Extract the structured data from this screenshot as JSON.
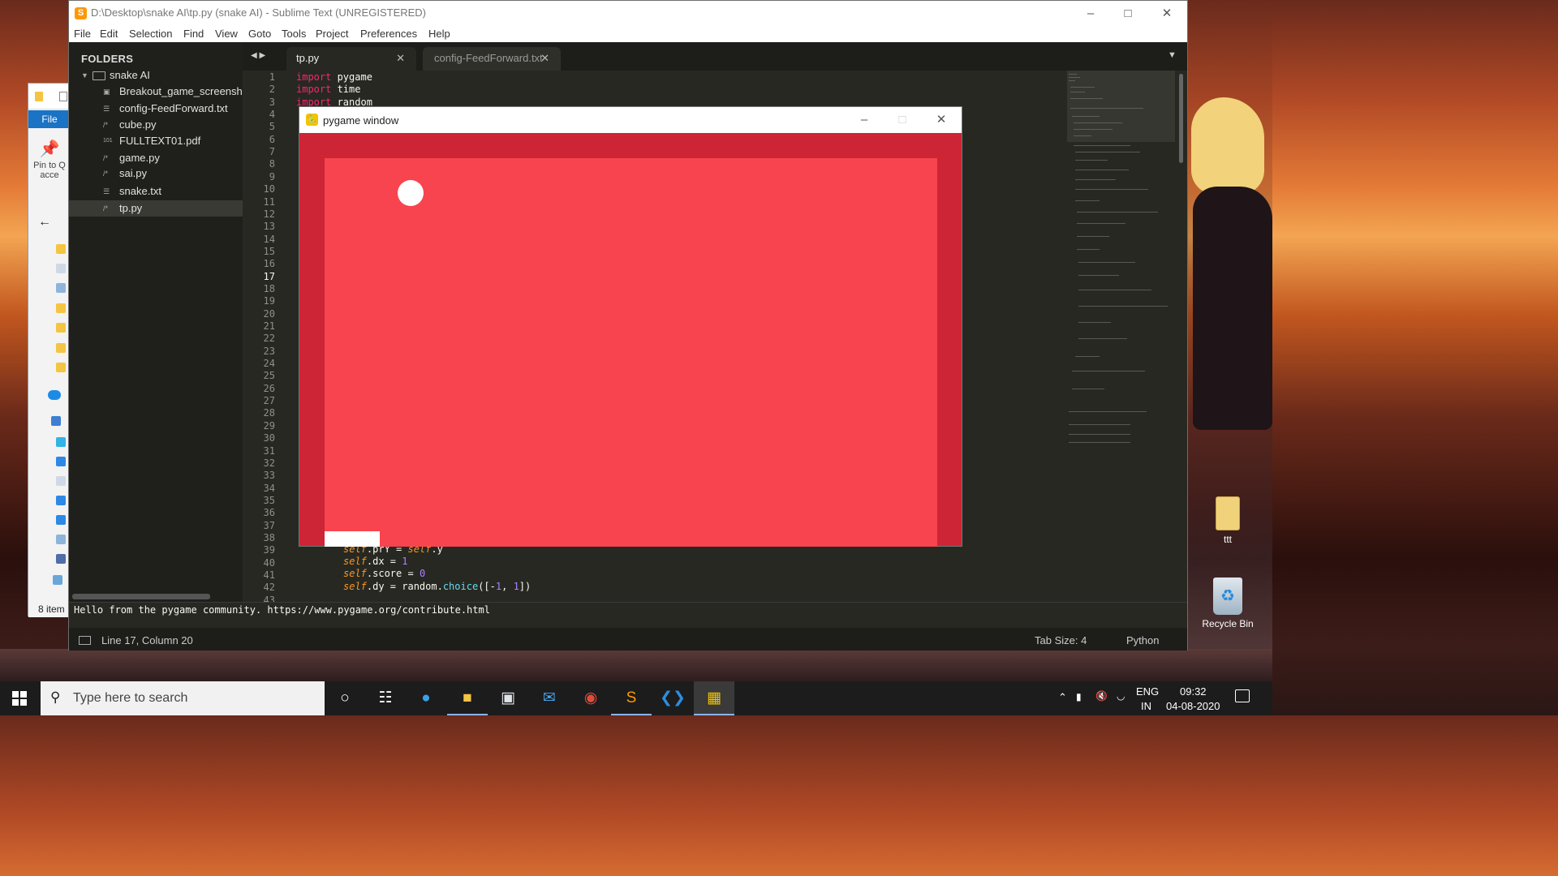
{
  "sublime": {
    "title": "D:\\Desktop\\snake AI\\tp.py (snake AI) - Sublime Text (UNREGISTERED)",
    "menu": [
      "File",
      "Edit",
      "Selection",
      "Find",
      "View",
      "Goto",
      "Tools",
      "Project",
      "Preferences",
      "Help"
    ],
    "sidebar": {
      "header": "FOLDERS",
      "root": "snake AI",
      "items": [
        {
          "label": "Breakout_game_screensh",
          "icon": "image-icon"
        },
        {
          "label": "config-FeedForward.txt",
          "icon": "text-icon"
        },
        {
          "label": "cube.py",
          "icon": "code-icon"
        },
        {
          "label": "FULLTEXT01.pdf",
          "icon": "binary-icon"
        },
        {
          "label": "game.py",
          "icon": "code-icon"
        },
        {
          "label": "sai.py",
          "icon": "code-icon"
        },
        {
          "label": "snake.txt",
          "icon": "text-icon"
        },
        {
          "label": "tp.py",
          "icon": "code-icon"
        }
      ]
    },
    "tabs": [
      {
        "label": "tp.py",
        "active": true
      },
      {
        "label": "config-FeedForward.txt",
        "active": false
      }
    ],
    "line_numbers": [
      "1",
      "2",
      "3",
      "4",
      "5",
      "6",
      "7",
      "8",
      "9",
      "10",
      "11",
      "12",
      "13",
      "14",
      "15",
      "16",
      "17",
      "18",
      "19",
      "20",
      "21",
      "22",
      "23",
      "24",
      "25",
      "26",
      "27",
      "28",
      "29",
      "30",
      "31",
      "32",
      "33",
      "34",
      "35",
      "36",
      "37",
      "38",
      "39",
      "40",
      "41",
      "42",
      "43"
    ],
    "current_line": 17,
    "code": {
      "l1_kw": "import",
      "l1_id": " pygame",
      "l2_kw": "import",
      "l2_id": " time",
      "l3_kw": "import",
      "l3_id": " random",
      "l39_a": "self",
      "l39_b": ".prY = ",
      "l39_c": "self",
      "l39_d": ".y",
      "l40_a": "self",
      "l40_b": ".dx = ",
      "l40_c": "1",
      "l41_a": "self",
      "l41_b": ".score = ",
      "l41_c": "0",
      "l42_a": "self",
      "l42_b": ".dy = random.",
      "l42_c": "choice",
      "l42_d": "([-",
      "l42_e": "1",
      "l42_f": ", ",
      "l42_g": "1",
      "l42_h": "])"
    },
    "console": "Hello from the pygame community. https://www.pygame.org/contribute.html",
    "status": {
      "position": "Line 17, Column 20",
      "tab_size": "Tab Size: 4",
      "syntax": "Python"
    }
  },
  "pygame": {
    "title": "pygame window",
    "bg": "#cd2436",
    "field": "#f7444e"
  },
  "explorer": {
    "file_tab": "File",
    "pin_label": "Pin to Q acce",
    "status": "8 item"
  },
  "desktop": {
    "icons": [
      {
        "label": "ttt"
      },
      {
        "label": "Recycle Bin"
      }
    ]
  },
  "taskbar": {
    "search_placeholder": "Type here to search",
    "lang": "ENG",
    "region": "IN",
    "time": "09:32",
    "date": "04-08-2020"
  }
}
